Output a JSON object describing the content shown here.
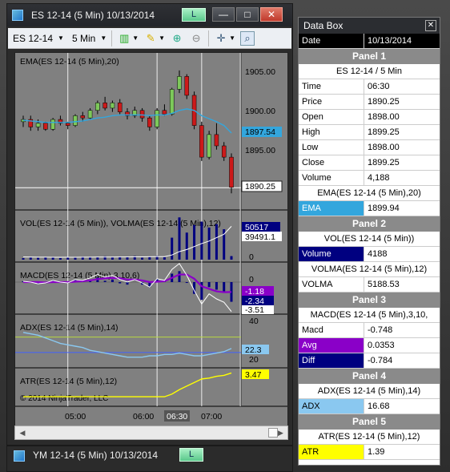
{
  "chart_window": {
    "title": "ES 12-14 (5 Min)  10/13/2014",
    "l_button": "L",
    "minimize": "—",
    "maximize": "□",
    "close": "✕",
    "toolbar": {
      "instrument": "ES 12-14",
      "interval": "5 Min"
    }
  },
  "second_window": {
    "title": "YM 12-14 (5 Min)  10/13/2014",
    "l_button": "L"
  },
  "colors": {
    "ema": "#33a6dd",
    "volume_bar": "#000080",
    "macd_avg": "#8a00c8",
    "adx": "#8ac8f0",
    "atr": "#ffff00",
    "up_candle": "#7dc85a",
    "down_candle": "#cc1a1a"
  },
  "chart_data": [
    {
      "type": "line",
      "panel": "price",
      "title": "EMA(ES 12-14 (5 Min),20)",
      "y_ticks": [
        "1905.00",
        "1900.00",
        "1895.00"
      ],
      "ylim": [
        1889,
        1906
      ],
      "last_price_label": "1890.25",
      "ema_label": "1897.54",
      "candles": [
        {
          "o": 1899.0,
          "h": 1899.8,
          "l": 1898.3,
          "c": 1899.3
        },
        {
          "o": 1899.3,
          "h": 1899.8,
          "l": 1897.8,
          "c": 1898.3
        },
        {
          "o": 1898.3,
          "h": 1899.3,
          "l": 1897.8,
          "c": 1898.8
        },
        {
          "o": 1898.8,
          "h": 1899.0,
          "l": 1897.8,
          "c": 1898.0
        },
        {
          "o": 1898.0,
          "h": 1899.5,
          "l": 1897.8,
          "c": 1899.3
        },
        {
          "o": 1899.3,
          "h": 1899.8,
          "l": 1898.5,
          "c": 1898.8
        },
        {
          "o": 1898.8,
          "h": 1899.0,
          "l": 1898.0,
          "c": 1898.5
        },
        {
          "o": 1898.5,
          "h": 1900.0,
          "l": 1898.3,
          "c": 1899.8
        },
        {
          "o": 1899.8,
          "h": 1900.3,
          "l": 1899.0,
          "c": 1899.5
        },
        {
          "o": 1899.5,
          "h": 1900.8,
          "l": 1899.3,
          "c": 1900.5
        },
        {
          "o": 1900.5,
          "h": 1901.8,
          "l": 1900.0,
          "c": 1901.5
        },
        {
          "o": 1901.5,
          "h": 1902.3,
          "l": 1900.5,
          "c": 1900.8
        },
        {
          "o": 1900.8,
          "h": 1901.8,
          "l": 1900.3,
          "c": 1901.5
        },
        {
          "o": 1901.5,
          "h": 1902.0,
          "l": 1900.0,
          "c": 1900.3
        },
        {
          "o": 1900.3,
          "h": 1900.8,
          "l": 1899.3,
          "c": 1899.8
        },
        {
          "o": 1899.8,
          "h": 1901.0,
          "l": 1899.5,
          "c": 1900.5
        },
        {
          "o": 1900.5,
          "h": 1900.8,
          "l": 1899.0,
          "c": 1899.5
        },
        {
          "o": 1899.5,
          "h": 1899.8,
          "l": 1897.8,
          "c": 1898.3
        },
        {
          "o": 1898.3,
          "h": 1900.8,
          "l": 1898.0,
          "c": 1900.5
        },
        {
          "o": 1900.5,
          "h": 1901.3,
          "l": 1899.8,
          "c": 1900.0
        },
        {
          "o": 1900.0,
          "h": 1903.5,
          "l": 1899.8,
          "c": 1903.3
        },
        {
          "o": 1903.3,
          "h": 1905.8,
          "l": 1902.8,
          "c": 1905.0
        },
        {
          "o": 1905.0,
          "h": 1905.3,
          "l": 1902.0,
          "c": 1902.5
        },
        {
          "o": 1902.5,
          "h": 1903.0,
          "l": 1898.0,
          "c": 1898.5
        },
        {
          "o": 1898.5,
          "h": 1899.0,
          "l": 1893.8,
          "c": 1894.3
        },
        {
          "o": 1894.3,
          "h": 1897.8,
          "l": 1894.0,
          "c": 1897.3
        },
        {
          "o": 1897.3,
          "h": 1898.8,
          "l": 1895.3,
          "c": 1895.8
        },
        {
          "o": 1895.8,
          "h": 1896.3,
          "l": 1893.8,
          "c": 1894.3
        },
        {
          "o": 1894.3,
          "h": 1894.8,
          "l": 1889.5,
          "c": 1890.3
        }
      ],
      "ema": [
        1899.2,
        1899.1,
        1899.0,
        1898.9,
        1898.9,
        1898.9,
        1898.9,
        1899.0,
        1899.1,
        1899.3,
        1899.5,
        1899.6,
        1899.8,
        1899.9,
        1899.9,
        1899.9,
        1899.9,
        1899.8,
        1899.9,
        1899.9,
        1900.1,
        1900.5,
        1900.7,
        1900.5,
        1899.8,
        1899.4,
        1899.0,
        1898.5,
        1897.5
      ]
    },
    {
      "type": "bar",
      "panel": "volume",
      "title": "VOL(ES 12-14 (5 Min)), VOLMA(ES 12-14 (5 Min),12)",
      "vol_label": "50517",
      "volma_label": "39491.1",
      "zero_label": "0",
      "values": [
        1800,
        2500,
        2200,
        3100,
        2600,
        1900,
        2800,
        2300,
        3500,
        2900,
        3200,
        4000,
        2700,
        3600,
        3000,
        4200,
        2400,
        3300,
        4400,
        2900,
        26000,
        50000,
        32000,
        41000,
        45000,
        38000,
        42000,
        36000,
        4188
      ],
      "volma": [
        3200,
        3100,
        3000,
        2950,
        2900,
        2900,
        2850,
        2900,
        2950,
        3000,
        3050,
        3100,
        3100,
        3150,
        3200,
        3300,
        3350,
        3400,
        3500,
        3550,
        5500,
        9500,
        12000,
        15500,
        19000,
        22000,
        26000,
        30000,
        39491
      ]
    },
    {
      "type": "line",
      "panel": "macd",
      "title": "MACD(ES 12-14 (5 Min),3,10,6)",
      "labels": [
        "-1.18",
        "-2.34",
        "-3.51"
      ],
      "zero_label": "0",
      "macd": [
        0.1,
        0.0,
        -0.2,
        -0.1,
        0.2,
        0.0,
        -0.1,
        0.3,
        0.2,
        0.5,
        0.9,
        0.6,
        0.8,
        0.3,
        0.0,
        0.3,
        -0.1,
        -0.6,
        0.4,
        0.2,
        1.5,
        2.2,
        0.8,
        -1.0,
        -2.6,
        -1.4,
        -2.0,
        -2.4,
        -3.5
      ],
      "avg": [
        0.0,
        0.0,
        0.0,
        -0.05,
        0.0,
        0.0,
        0.0,
        0.05,
        0.1,
        0.2,
        0.35,
        0.45,
        0.5,
        0.45,
        0.3,
        0.3,
        0.2,
        0.0,
        0.05,
        0.1,
        0.5,
        0.9,
        0.9,
        0.4,
        -0.5,
        -0.8,
        -1.1,
        -1.2,
        -1.18
      ],
      "diff": [
        0.1,
        0.0,
        -0.2,
        -0.05,
        0.2,
        0.0,
        -0.1,
        0.25,
        0.1,
        0.3,
        0.55,
        0.15,
        0.3,
        -0.15,
        -0.3,
        0.0,
        -0.3,
        -0.6,
        0.35,
        0.1,
        1.0,
        1.3,
        -0.1,
        -1.4,
        -2.1,
        -0.6,
        -0.9,
        -1.2,
        -2.34
      ]
    },
    {
      "type": "line",
      "panel": "adx",
      "title": "ADX(ES 12-14 (5 Min),14)",
      "y_ticks": [
        "40",
        "20"
      ],
      "adx_label": "22.3",
      "values": [
        34,
        33,
        32,
        30,
        28,
        26,
        25,
        24,
        23,
        21,
        20,
        19,
        18,
        17,
        16,
        16,
        16,
        17,
        17,
        18,
        18,
        19,
        18,
        17,
        17,
        18,
        19,
        20,
        22.3
      ]
    },
    {
      "type": "line",
      "panel": "atr",
      "title": "ATR(ES 12-14 (5 Min),12)",
      "atr_label": "3.47",
      "copyright": "© 2014 NinjaTrader, LLC",
      "values": [
        0.8,
        0.8,
        0.8,
        0.8,
        0.8,
        0.8,
        0.8,
        0.8,
        0.8,
        0.8,
        0.8,
        0.8,
        0.8,
        0.8,
        0.8,
        0.8,
        0.8,
        0.8,
        0.8,
        0.8,
        1.1,
        1.6,
        2.0,
        2.4,
        2.8,
        2.9,
        3.1,
        3.2,
        3.47
      ]
    },
    {
      "type": "line",
      "panel": "time_axis",
      "x_ticks": [
        "05:00",
        "06:00",
        "06:30",
        "07:00"
      ]
    }
  ],
  "data_box": {
    "title": "Data Box",
    "close": "✕",
    "date_label": "Date",
    "date_value": "10/13/2014",
    "panel1": "Panel 1",
    "instrument": "ES 12-14 / 5 Min",
    "rows": [
      {
        "k": "Time",
        "v": "06:30"
      },
      {
        "k": "Price",
        "v": "1890.25"
      },
      {
        "k": "Open",
        "v": "1898.00"
      },
      {
        "k": "High",
        "v": "1899.25"
      },
      {
        "k": "Low",
        "v": "1898.00"
      },
      {
        "k": "Close",
        "v": "1899.25"
      },
      {
        "k": "Volume",
        "v": "4,188"
      }
    ],
    "ema_header": "EMA(ES 12-14 (5 Min),20)",
    "ema_k": "EMA",
    "ema_v": "1899.94",
    "panel2": "Panel 2",
    "vol_header": "VOL(ES 12-14 (5 Min))",
    "vol_k": "Volume",
    "vol_v": "4188",
    "volma_header": "VOLMA(ES 12-14 (5 Min),12)",
    "volma_k": "VOLMA",
    "volma_v": "5188.53",
    "panel3": "Panel 3",
    "macd_header": "MACD(ES 12-14 (5 Min),3,10,",
    "macd_k": "Macd",
    "macd_v": "-0.748",
    "avg_k": "Avg",
    "avg_v": "0.0353",
    "diff_k": "Diff",
    "diff_v": "-0.784",
    "panel4": "Panel 4",
    "adx_header": "ADX(ES 12-14 (5 Min),14)",
    "adx_k": "ADX",
    "adx_v": "16.68",
    "panel5": "Panel 5",
    "atr_header": "ATR(ES 12-14 (5 Min),12)",
    "atr_k": "ATR",
    "atr_v": "1.39"
  }
}
